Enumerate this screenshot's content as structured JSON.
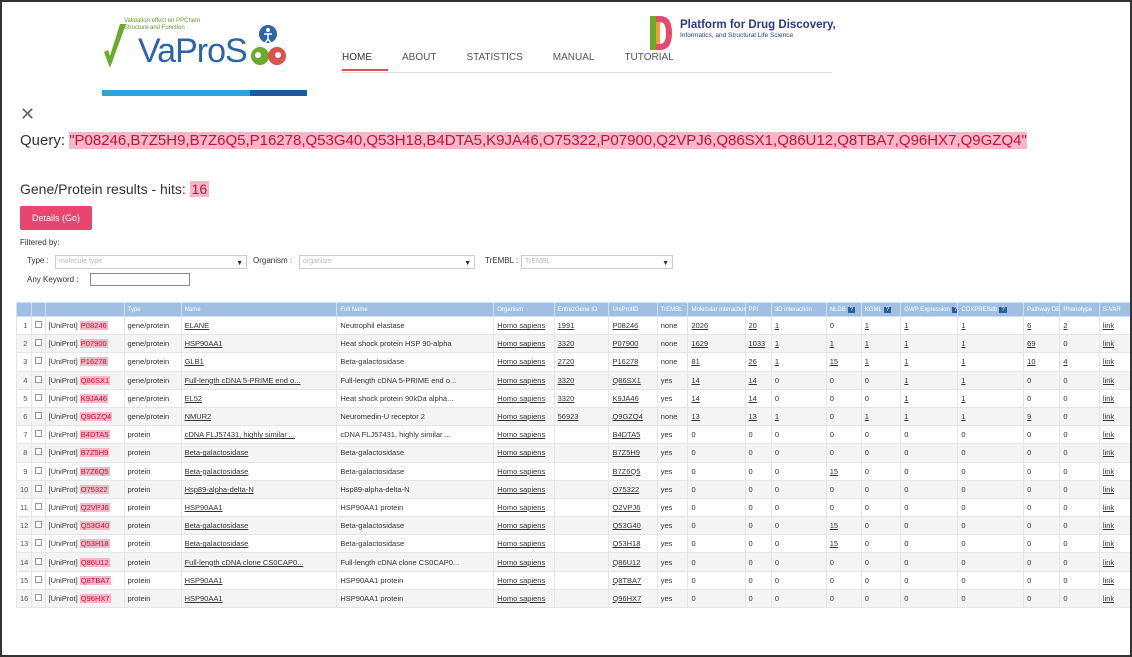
{
  "header": {
    "logo_tagline": "Validation effect on PPChem Structure and Function",
    "logo_name": "VaProS",
    "nav": [
      "HOME",
      "ABOUT",
      "STATISTICS",
      "MANUAL",
      "TUTORIAL"
    ],
    "partner_title": "Platform for Drug Discovery,",
    "partner_subtitle": "Informatics, and Structural Life Science"
  },
  "query": {
    "label": "Query:",
    "value": "\"P08246,B7Z5H9,B7Z6Q5,P16278,Q53G40,Q53H18,B4DTA5,K9JA46,O75322,P07900,Q2VPJ6,Q86SX1,Q86U12,Q8TBA7,Q96HX7,Q9GZQ4\""
  },
  "results": {
    "title": "Gene/Protein results - hits:",
    "hits": "16",
    "details_button": "Details (Go)"
  },
  "filters": {
    "label": "Filtered by:",
    "type_label": "Type :",
    "type_placeholder": "molecule type",
    "organism_label": "Organism :",
    "organism_placeholder": "organism",
    "trembl_label": "TrEMBL :",
    "trembl_placeholder": "TrEMBL",
    "keyword_label": "Any Keyword :"
  },
  "table": {
    "headers": [
      "",
      "",
      "",
      "Type",
      "Name",
      "Full Name",
      "Organism",
      "EntrezGene ID",
      "UniProtID",
      "TrEMBL",
      "Molecular interactions",
      "PPI",
      "3D interaction",
      "NLDB",
      "KGML",
      "GWP Expression",
      "COXPRESdb",
      "Pathway DB",
      "Phenotype",
      "S-VAR"
    ],
    "rows": [
      [
        "1",
        "[UniProt]",
        "P08246",
        "gene/protein",
        "ELANE",
        "Neutrophil elastase",
        "Homo sapiens",
        "1991",
        "P08246",
        "none",
        "2026",
        "20",
        "1",
        "0",
        "1",
        "1",
        "1",
        "6",
        "2",
        "link"
      ],
      [
        "2",
        "[UniProt]",
        "P07900",
        "gene/protein",
        "HSP90AA1",
        "Heat shock protein HSP 90-alpha",
        "Homo sapiens",
        "3320",
        "P07900",
        "none",
        "1629",
        "1033",
        "1",
        "1",
        "1",
        "1",
        "1",
        "69",
        "0",
        "link"
      ],
      [
        "3",
        "[UniProt]",
        "P16278",
        "gene/protein",
        "GLB1",
        "Beta-galactosidase",
        "Homo sapiens",
        "2720",
        "P16278",
        "none",
        "81",
        "26",
        "1",
        "15",
        "1",
        "1",
        "1",
        "10",
        "4",
        "link"
      ],
      [
        "4",
        "[UniProt]",
        "Q86SX1",
        "gene/protein",
        "Full-length cDNA 5-PRIME end o...",
        "Full-length cDNA 5-PRIME end o...",
        "Homo sapiens",
        "3320",
        "Q86SX1",
        "yes",
        "14",
        "14",
        "0",
        "0",
        "0",
        "1",
        "1",
        "0",
        "0",
        "link"
      ],
      [
        "5",
        "[UniProt]",
        "K9JA46",
        "gene/protein",
        "EL52",
        "Heat shock protein 90kDa alpha...",
        "Homo sapiens",
        "3320",
        "K9JA46",
        "yes",
        "14",
        "14",
        "0",
        "0",
        "0",
        "1",
        "1",
        "0",
        "0",
        "link"
      ],
      [
        "6",
        "[UniProt]",
        "Q9GZQ4",
        "gene/protein",
        "NMUR2",
        "Neuromedin-U receptor 2",
        "Homo sapiens",
        "56923",
        "Q9GZQ4",
        "none",
        "13",
        "13",
        "1",
        "0",
        "1",
        "1",
        "1",
        "9",
        "0",
        "link"
      ],
      [
        "7",
        "[UniProt]",
        "B4DTA5",
        "protein",
        "cDNA FLJ57431, highly similar ...",
        "cDNA FLJ57431, highly similar ...",
        "Homo sapiens",
        "",
        "B4DTA5",
        "yes",
        "0",
        "0",
        "0",
        "0",
        "0",
        "0",
        "0",
        "0",
        "0",
        "link"
      ],
      [
        "8",
        "[UniProt]",
        "B7Z5H9",
        "protein",
        "Beta-galactosidase",
        "Beta-galactosidase",
        "Homo sapiens",
        "",
        "B7Z5H9",
        "yes",
        "0",
        "0",
        "0",
        "0",
        "0",
        "0",
        "0",
        "0",
        "0",
        "link"
      ],
      [
        "9",
        "[UniProt]",
        "B7Z6Q5",
        "protein",
        "Beta-galactosidase",
        "Beta-galactosidase",
        "Homo sapiens",
        "",
        "B7Z6Q5",
        "yes",
        "0",
        "0",
        "0",
        "15",
        "0",
        "0",
        "0",
        "0",
        "0",
        "link"
      ],
      [
        "10",
        "[UniProt]",
        "O75322",
        "protein",
        "Hsp89-alpha-delta-N",
        "Hsp89-alpha-delta-N",
        "Homo sapiens",
        "",
        "O75322",
        "yes",
        "0",
        "0",
        "0",
        "0",
        "0",
        "0",
        "0",
        "0",
        "0",
        "link"
      ],
      [
        "11",
        "[UniProt]",
        "Q2VPJ6",
        "protein",
        "HSP90AA1",
        "HSP90AA1 protein",
        "Homo sapiens",
        "",
        "Q2VPJ6",
        "yes",
        "0",
        "0",
        "0",
        "0",
        "0",
        "0",
        "0",
        "0",
        "0",
        "link"
      ],
      [
        "12",
        "[UniProt]",
        "Q53G40",
        "protein",
        "Beta-galactosidase",
        "Beta-galactosidase",
        "Homo sapiens",
        "",
        "Q53G40",
        "yes",
        "0",
        "0",
        "0",
        "15",
        "0",
        "0",
        "0",
        "0",
        "0",
        "link"
      ],
      [
        "13",
        "[UniProt]",
        "Q53H18",
        "protein",
        "Beta-galactosidase",
        "Beta-galactosidase",
        "Homo sapiens",
        "",
        "Q53H18",
        "yes",
        "0",
        "0",
        "0",
        "15",
        "0",
        "0",
        "0",
        "0",
        "0",
        "link"
      ],
      [
        "14",
        "[UniProt]",
        "Q86U12",
        "protein",
        "Full-length cDNA clone CS0CAP0...",
        "Full-length cDNA clone CS0CAP0...",
        "Homo sapiens",
        "",
        "Q86U12",
        "yes",
        "0",
        "0",
        "0",
        "0",
        "0",
        "0",
        "0",
        "0",
        "0",
        "link"
      ],
      [
        "15",
        "[UniProt]",
        "Q8TBA7",
        "protein",
        "HSP90AA1",
        "HSP90AA1 protein",
        "Homo sapiens",
        "",
        "Q8TBA7",
        "yes",
        "0",
        "0",
        "0",
        "0",
        "0",
        "0",
        "0",
        "0",
        "0",
        "link"
      ],
      [
        "16",
        "[UniProt]",
        "Q96HX7",
        "protein",
        "HSP90AA1",
        "HSP90AA1 protein",
        "Homo sapiens",
        "",
        "Q96HX7",
        "yes",
        "0",
        "0",
        "0",
        "0",
        "0",
        "0",
        "0",
        "0",
        "0",
        "link"
      ]
    ]
  },
  "colors": {
    "accent": "#e8456f",
    "highlight": "#f6b7c6",
    "table_header": "#9fc0e4",
    "brand_blue": "#2f63a8"
  }
}
